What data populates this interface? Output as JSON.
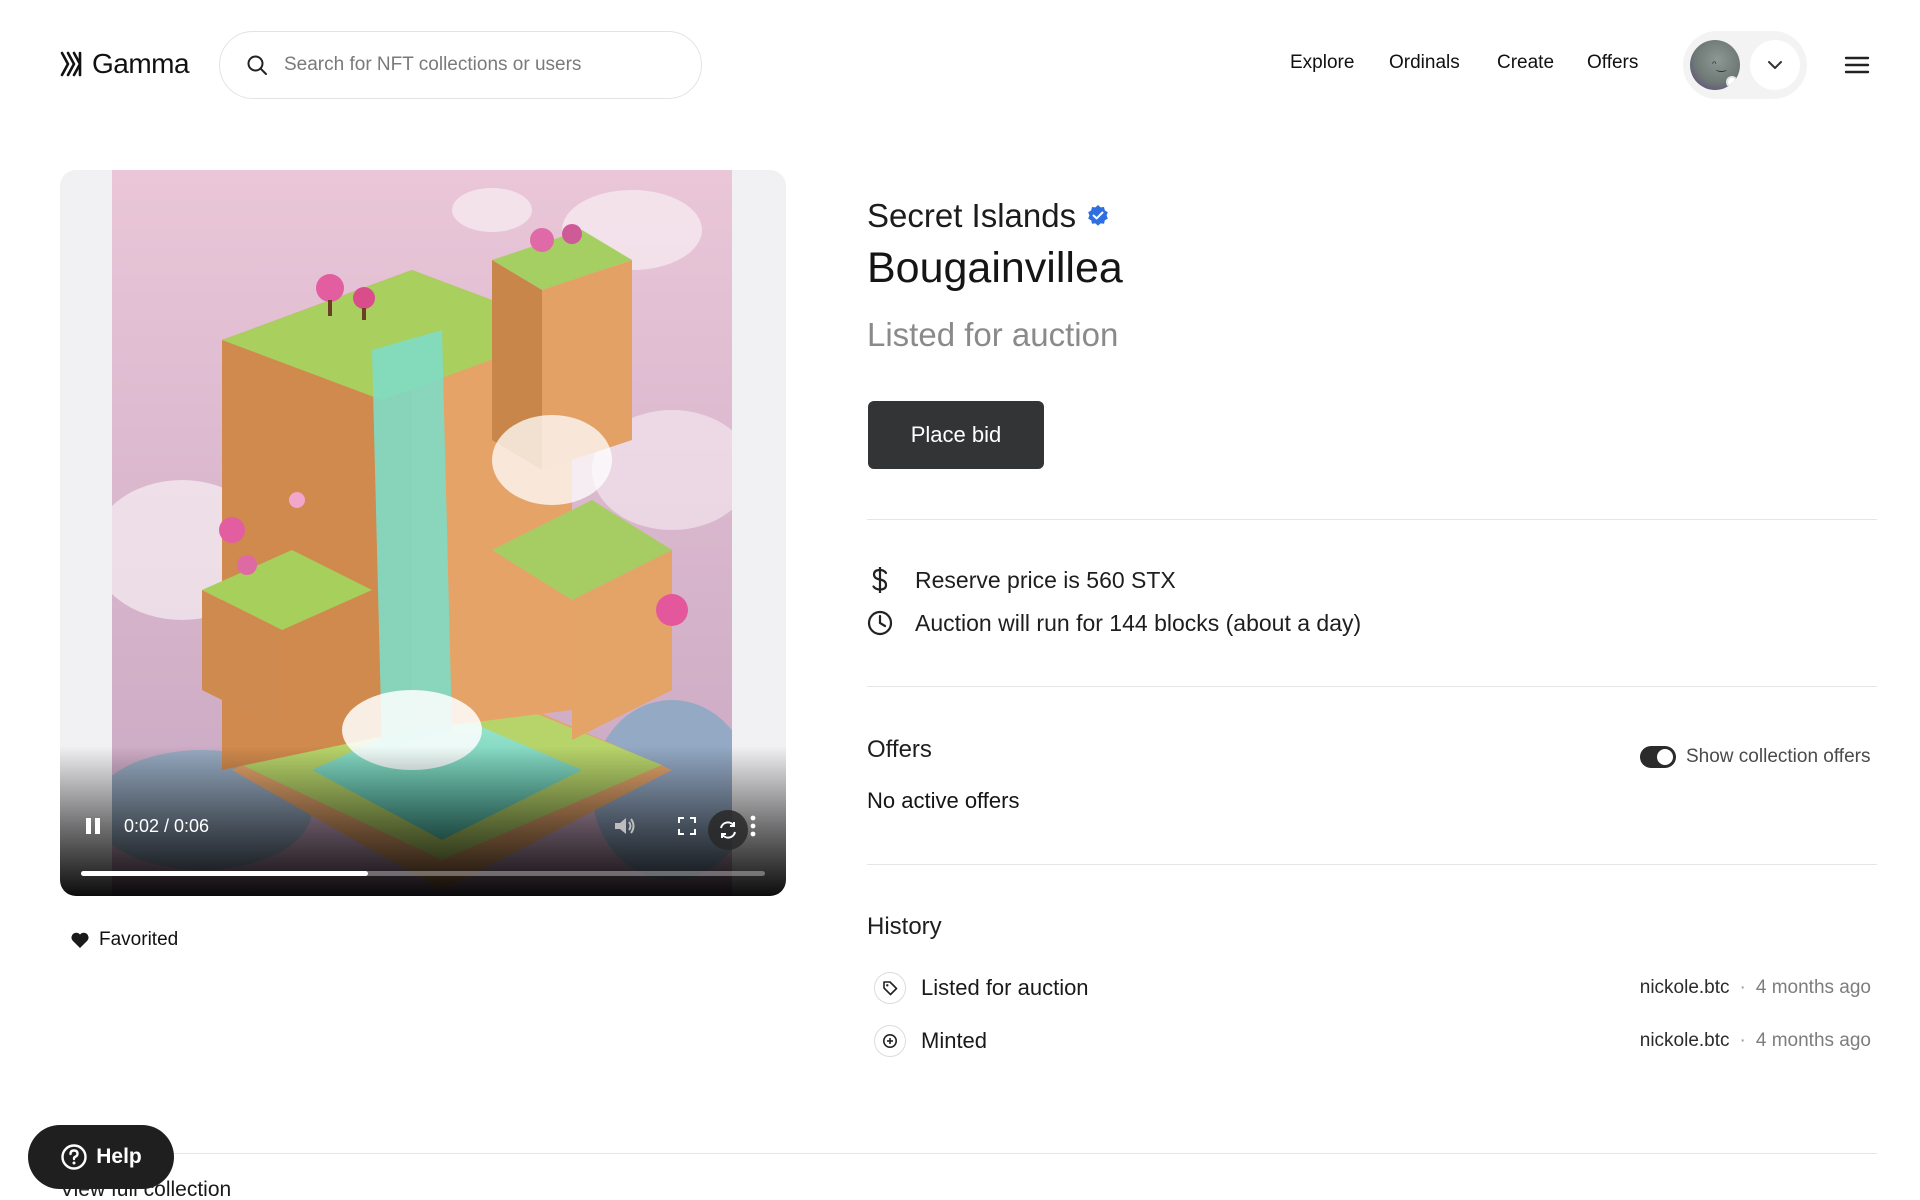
{
  "header": {
    "logo_text": "Gamma",
    "search_placeholder": "Search for NFT collections or users",
    "nav": [
      "Explore",
      "Ordinals",
      "Create",
      "Offers"
    ]
  },
  "media": {
    "time_readout": "0:02 / 0:06",
    "progress_fraction": 0.42
  },
  "favorite": {
    "label": "Favorited"
  },
  "token": {
    "collection": "Secret Islands",
    "title": "Bougainvillea",
    "status": "Listed for auction",
    "bid_label": "Place bid"
  },
  "auction_info": {
    "reserve": "Reserve price is 560 STX",
    "duration": "Auction will run for 144 blocks (about a day)"
  },
  "offers": {
    "title": "Offers",
    "toggle_label": "Show collection offers",
    "toggle_on": true,
    "empty": "No active offers"
  },
  "history": {
    "title": "History",
    "rows": [
      {
        "icon": "tag-icon",
        "label": "Listed for auction",
        "user": "nickole.btc",
        "dot": "·",
        "time": "4 months ago"
      },
      {
        "icon": "plus-circle-icon",
        "label": "Minted",
        "user": "nickole.btc",
        "dot": "·",
        "time": "4 months ago"
      }
    ]
  },
  "footer": {
    "view_full": "View full collection",
    "help_label": "Help"
  },
  "colors": {
    "button_dark": "#333436",
    "verified": "#2f6fdf",
    "muted_text": "#8a8a8a"
  }
}
